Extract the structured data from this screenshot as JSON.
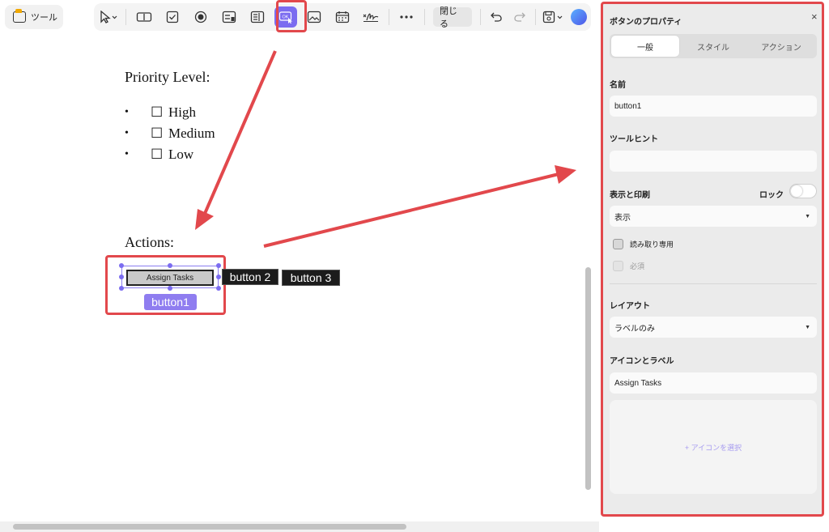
{
  "tools": {
    "label": "ツール"
  },
  "toolbar": {
    "close_label": "閉じる",
    "active_button_text": "OK"
  },
  "document": {
    "priority_heading": "Priority Level:",
    "priority_items": [
      "High",
      "Medium",
      "Low"
    ],
    "bullet": "•",
    "checkbox_glyph": "☐",
    "actions_heading": "Actions:",
    "buttons": [
      "Assign Tasks",
      "button 2",
      "button 3"
    ],
    "selected_field_name": "button1"
  },
  "panel": {
    "title": "ボタンのプロパティ",
    "close": "×",
    "tabs": [
      "一般",
      "スタイル",
      "アクション"
    ],
    "active_tab": "一般",
    "name_label": "名前",
    "name_value": "button1",
    "tooltip_label": "ツールヒント",
    "tooltip_value": "",
    "display_print_label": "表示と印刷",
    "lock_label": "ロック",
    "lock_on": false,
    "visibility_value": "表示",
    "readonly_label": "読み取り専用",
    "required_label": "必須",
    "layout_label": "レイアウト",
    "layout_value": "ラベルのみ",
    "icon_label_section": "アイコンとラベル",
    "label_value": "Assign Tasks",
    "select_icon": "+ アイコンを選択"
  },
  "colors": {
    "accent": "#7b6cf0",
    "annotation_red": "#e2484c"
  }
}
